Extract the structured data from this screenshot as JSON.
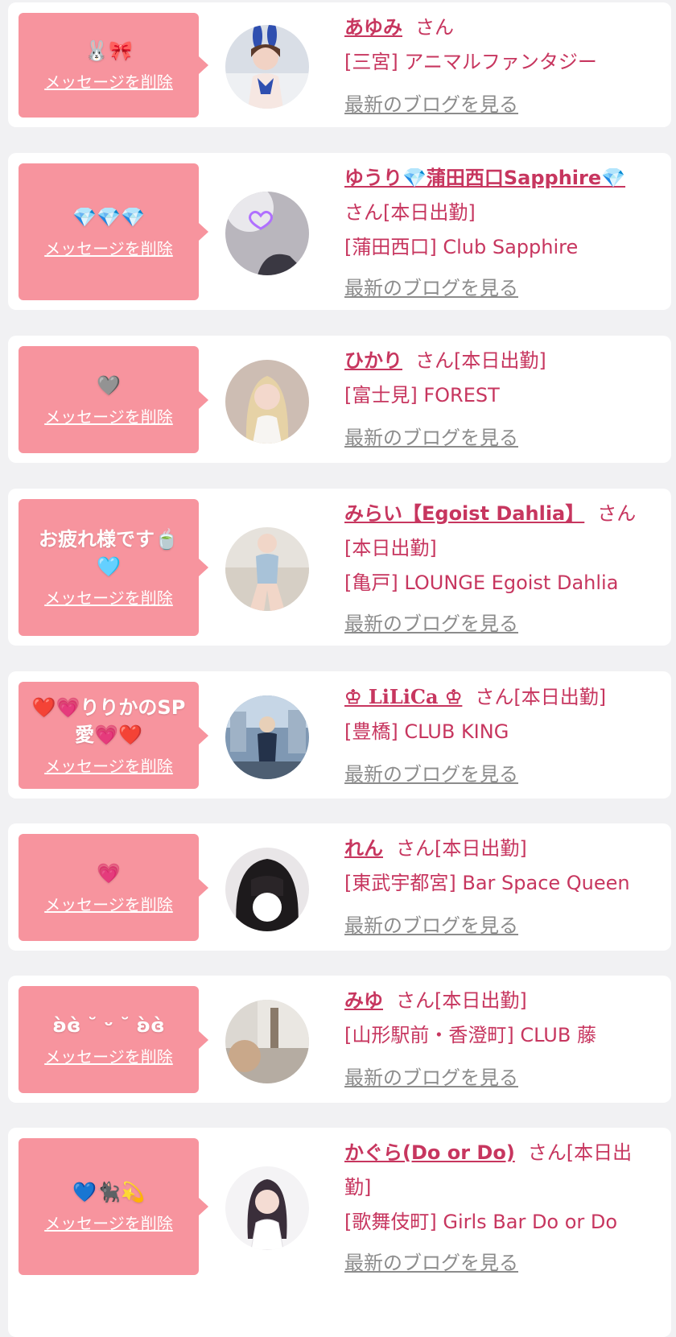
{
  "delete_label": "メッセージを削除",
  "blog_label": "最新のブログを見る",
  "san": "さん",
  "colors": {
    "accent": "#c7365f",
    "bubble": "#f7949e",
    "link_gray": "#8c8c8c",
    "card": "#ffffff",
    "page": "#f1f1f3"
  },
  "items": [
    {
      "message": "🐰🎀",
      "name": "あゆみ",
      "status": "",
      "shop": "[三宮] アニマルファンタジー",
      "avatar": "avatar-bunny-costume"
    },
    {
      "message": "💎💎💎",
      "name": "ゆうり💎蒲田西口Sapphire💎",
      "status": "[本日出勤]",
      "shop": "[蒲田西口] Club Sapphire",
      "avatar": "avatar-neon-heart"
    },
    {
      "message": "🩶",
      "name": "ひかり",
      "status": "[本日出勤]",
      "shop": "[富士見] FOREST",
      "avatar": "avatar-blonde"
    },
    {
      "message": "お疲れ様です🍵 🩵",
      "name": "みらい【Egoist Dahlia】",
      "status": "[本日出勤]",
      "shop": "[亀戸] LOUNGE Egoist Dahlia",
      "avatar": "avatar-blue-dress"
    },
    {
      "message": "❤️💗りりかのSP愛💗❤️",
      "name": "♔ LiLiCa ♔",
      "status": "[本日出勤]",
      "shop": "[豊橋] CLUB KING",
      "avatar": "avatar-bar-room"
    },
    {
      "message": "💗",
      "name": "れん",
      "status": "[本日出勤]",
      "shop": "[東武宇都宮] Bar Space Queen",
      "avatar": "avatar-braids"
    },
    {
      "message": "ʚ̀ɞ̀ ˘ ᵕ ˘ ʚ̀ɞ̀",
      "name": "みゆ",
      "status": "[本日出勤]",
      "shop": "[山形駅前・香澄町] CLUB 藤",
      "avatar": "avatar-street"
    },
    {
      "message": "💙🐈‍⬛💫",
      "name": "かぐら(Do or Do)",
      "status": "[本日出勤]",
      "shop": "[歌舞伎町] Girls Bar Do or Do",
      "avatar": "avatar-white-dress"
    }
  ]
}
